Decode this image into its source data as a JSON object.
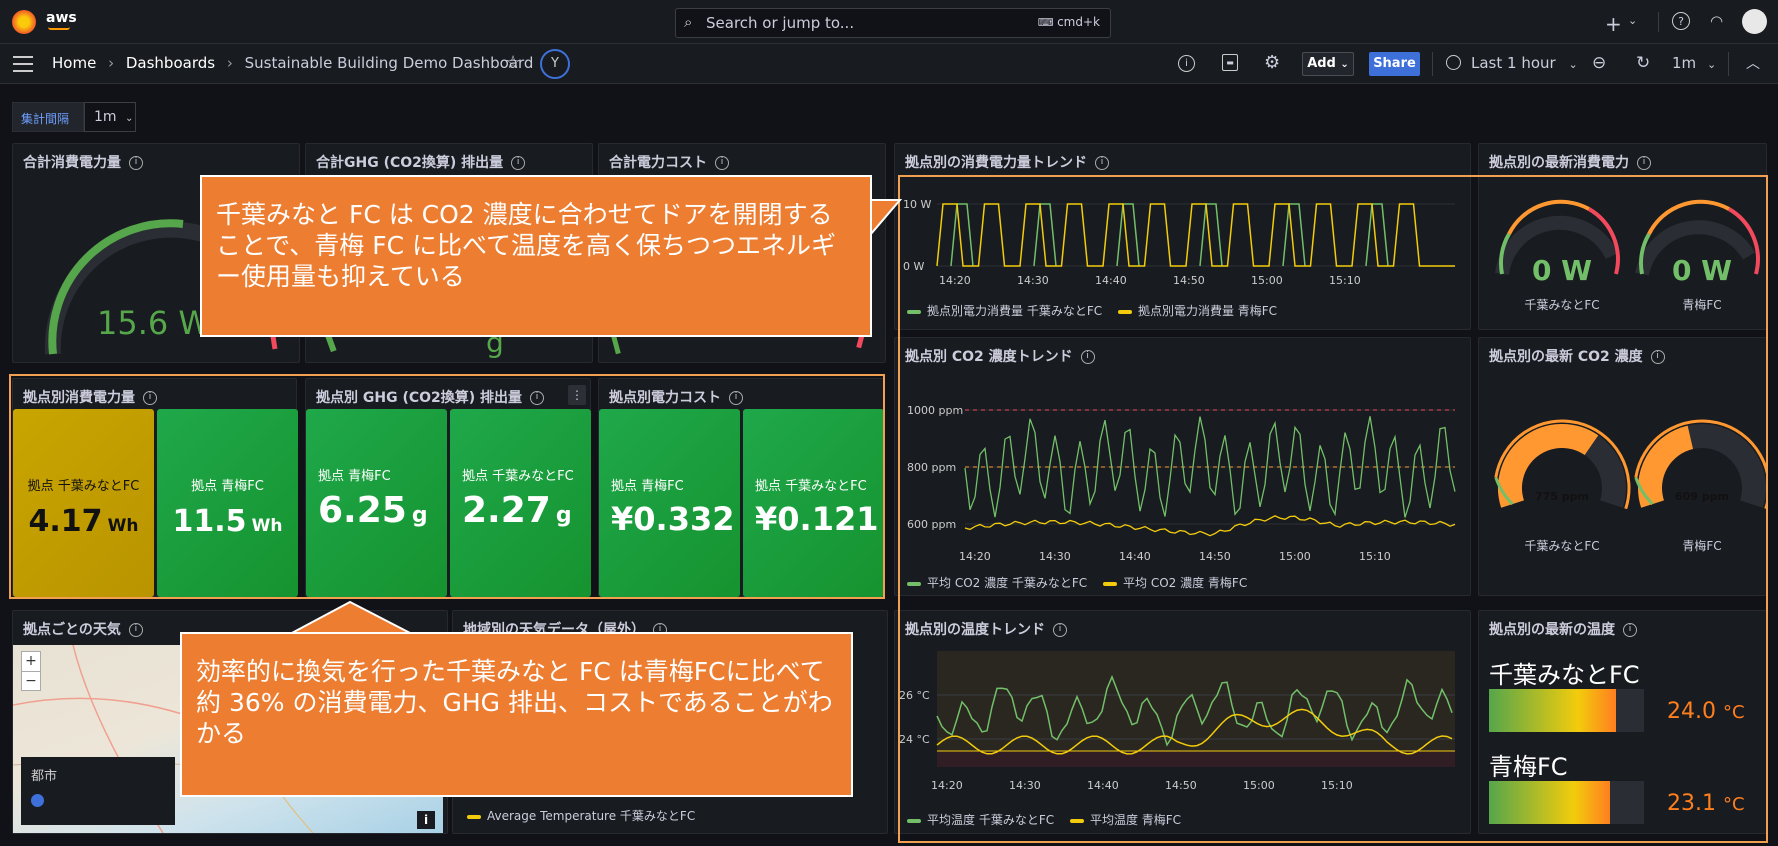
{
  "header": {
    "search_placeholder": "Search or jump to...",
    "search_shortcut": "cmd+k",
    "brand": "aws"
  },
  "breadcrumb": {
    "home": "Home",
    "dashboards": "Dashboards",
    "current": "Sustainable Building Demo Dashboard",
    "avatar": "Y"
  },
  "toolbar": {
    "add_label": "Add",
    "share_label": "Share",
    "time_range": "Last 1 hour",
    "refresh_interval": "1m"
  },
  "variables": {
    "interval_label": "集計間隔",
    "interval_value": "1m"
  },
  "panels": {
    "total_power": {
      "title": "合計消費電力量",
      "value": "15.6 Wh"
    },
    "total_ghg": {
      "title": "合計GHG (CO2換算) 排出量"
    },
    "total_cost": {
      "title": "合計電力コスト"
    },
    "power_trend": {
      "title": "拠点別の消費電力量トレンド",
      "y_ticks": [
        "10 W",
        "0 W"
      ],
      "x_ticks": [
        "14:20",
        "14:30",
        "14:40",
        "14:50",
        "15:00",
        "15:10"
      ],
      "legend_a": "拠点別電力消費量 千葉みなとFC",
      "legend_b": "拠点別電力消費量 青梅FC"
    },
    "latest_power": {
      "title": "拠点別の最新消費電力",
      "a_value": "0 W",
      "a_label": "千葉みなとFC",
      "b_value": "0 W",
      "b_label": "青梅FC"
    },
    "site_power": {
      "title": "拠点別消費電力量",
      "a_label": "拠点 千葉みなとFC",
      "a_value": "4.17",
      "a_unit": "Wh",
      "b_label": "拠点 青梅FC",
      "b_value": "11.5",
      "b_unit": "Wh"
    },
    "site_ghg": {
      "title": "拠点別 GHG (CO2換算) 排出量",
      "a_label": "拠点 青梅FC",
      "a_value": "6.25",
      "a_unit": "g",
      "b_label": "拠点 千葉みなとFC",
      "b_value": "2.27",
      "b_unit": "g"
    },
    "site_cost": {
      "title": "拠点別電力コスト",
      "a_label": "拠点 青梅FC",
      "a_value": "¥0.332",
      "b_label": "拠点 千葉みなとFC",
      "b_value": "¥0.121"
    },
    "co2_trend": {
      "title": "拠点別 CO2 濃度トレンド",
      "y_ticks": [
        "1000 ppm",
        "800 ppm",
        "600 ppm"
      ],
      "x_ticks": [
        "14:20",
        "14:30",
        "14:40",
        "14:50",
        "15:00",
        "15:10"
      ],
      "legend_a": "平均 CO2 濃度 千葉みなとFC",
      "legend_b": "平均 CO2 濃度 青梅FC"
    },
    "latest_co2": {
      "title": "拠点別の最新 CO2 濃度",
      "a_value": "775 ppm",
      "a_label": "千葉みなとFC",
      "a_level": 0.66,
      "b_value": "609 ppm",
      "b_label": "青梅FC",
      "b_level": 0.44
    },
    "weather_map": {
      "title": "拠点ごとの天気",
      "legend_title": "都市",
      "zoom_in": "+",
      "zoom_out": "−",
      "info": "i"
    },
    "regional_weather": {
      "title": "地域別の天気データ（屋外）",
      "legend": "Average Temperature 千葉みなとFC"
    },
    "temp_trend": {
      "title": "拠点別の温度トレンド",
      "y_ticks": [
        "26 °C",
        "24 °C"
      ],
      "x_ticks": [
        "14:20",
        "14:30",
        "14:40",
        "14:50",
        "15:00",
        "15:10"
      ],
      "legend_a": "平均温度 千葉みなとFC",
      "legend_b": "平均温度 青梅FC"
    },
    "latest_temp": {
      "title": "拠点別の最新の温度",
      "a_name": "千葉みなとFC",
      "a_value": "24.0",
      "a_unit": "°C",
      "a_level": 0.82,
      "b_name": "青梅FC",
      "b_value": "23.1",
      "b_unit": "°C",
      "b_level": 0.78
    }
  },
  "callouts": {
    "top": "千葉みなと FC は CO2 濃度に合わせてドアを開閉することで、青梅 FC に比べて温度を高く保ちつつエネルギー使用量も抑えている",
    "bottom": "効率的に換気を行った千葉みなと FC は青梅FCに比べて約 36% の消費電力、GHG 排出、コストであることがわかる"
  },
  "colors": {
    "green": "#73bf69",
    "yellow": "#f2cc0c",
    "orange": "#ff9830",
    "blue": "#3d71d9",
    "callout": "#ed7d31"
  }
}
